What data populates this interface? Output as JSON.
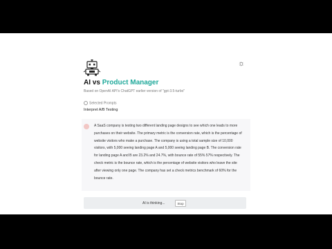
{
  "header": {
    "title_prefix": "AI vs ",
    "title_accent": "Product Manager",
    "subtitle": "Based on OpenAI API's ChatGPT earlier version of \"gpt-3.5-turbo\"",
    "accent_color": "#1ea89a",
    "theme_icon": "sun-icon",
    "logo_icon": "robot-icon"
  },
  "selected_prompt": {
    "label": "Selected Prompts",
    "value": "Interpret A/B Testing"
  },
  "message": {
    "avatar_color": "#f2c7c5",
    "text": "A SaaS company is testing two different landing page designs to see which one leads to more purchases on their website. The primary metric is the conversion rate, which is the percentage of website visitors who make a purchase. The company is using a total sample size of 10,000 visitors, with 5,000 seeing landing page A and 5,000 seeing landing page B. The conversion rate for landing page A and B are 23.2% and 24.7%, with bounce rate of 55% 57% respectively. The check metric is the bounce rate, which is the percentage of website visitors who leave the site after viewing only one page. The company has set a check metrics benchmark of 60% for the bounce rate."
  },
  "status": {
    "thinking": "AI is thinking...",
    "stop_label": "Stop"
  }
}
